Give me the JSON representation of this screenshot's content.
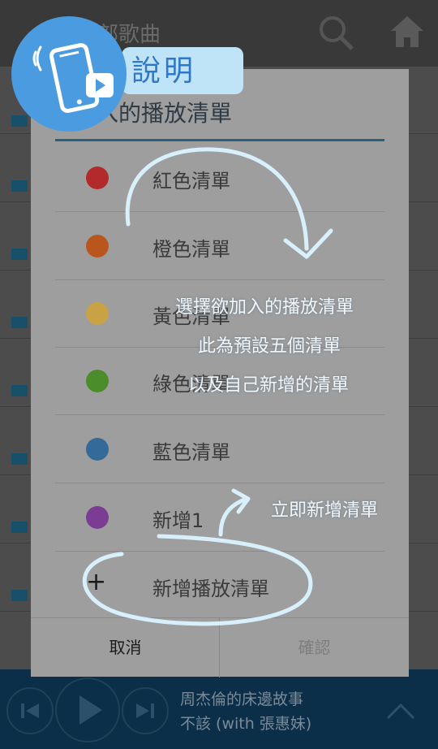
{
  "app": {
    "title": "部歌曲"
  },
  "player": {
    "song": "周杰倫的床邊故事",
    "artist": "不該 (with 張惠妹)"
  },
  "dialog": {
    "title": "加入的播放清單",
    "items": [
      {
        "label": "紅色清單",
        "color": "#b22a2a"
      },
      {
        "label": "橙色清單",
        "color": "#b8561e"
      },
      {
        "label": "黃色清單",
        "color": "#c9a245"
      },
      {
        "label": "綠色清單",
        "color": "#4b8d2b"
      },
      {
        "label": "藍色清單",
        "color": "#346a98"
      },
      {
        "label": "新增1",
        "color": "#7b3d94"
      }
    ],
    "add_label": "新增播放清單",
    "add_icon": "+",
    "cancel_label": "取消",
    "confirm_label": "確認"
  },
  "annotations": {
    "badge_label": "說明",
    "line1": "選擇欲加入的播放清單",
    "line2": "此為預設五個清單",
    "line3": "以及自己新增的清單",
    "new_hint": "立即新增清單"
  }
}
